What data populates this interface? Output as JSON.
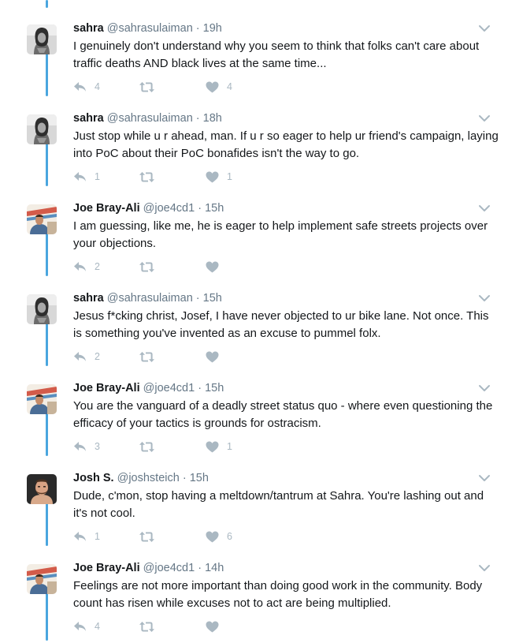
{
  "tweets": [
    {
      "avatar": "avatar-sahra",
      "name": "sahra",
      "handle": "@sahrasulaiman",
      "sep": "·",
      "time": "19h",
      "text": "I genuinely don't understand why you seem to think that folks can't care about traffic deaths AND black lives at the same time...",
      "reply_count": "4",
      "retweet_count": "",
      "like_count": "4"
    },
    {
      "avatar": "avatar-sahra",
      "name": "sahra",
      "handle": "@sahrasulaiman",
      "sep": "·",
      "time": "18h",
      "text": "Just stop while u r ahead, man. If u r so eager to help ur friend's campaign, laying into PoC about their PoC bonafides isn't the way to go.",
      "reply_count": "1",
      "retweet_count": "",
      "like_count": "1"
    },
    {
      "avatar": "avatar-joe",
      "name": "Joe Bray-Ali",
      "handle": "@joe4cd1",
      "sep": "·",
      "time": "15h",
      "text": "I am guessing, like me, he is eager to help implement safe streets projects over your objections.",
      "reply_count": "2",
      "retweet_count": "",
      "like_count": ""
    },
    {
      "avatar": "avatar-sahra",
      "name": "sahra",
      "handle": "@sahrasulaiman",
      "sep": "·",
      "time": "15h",
      "text": "Jesus f*cking christ, Josef, I have never objected to ur bike lane. Not once. This is something you've invented as an excuse to pummel folx.",
      "reply_count": "2",
      "retweet_count": "",
      "like_count": ""
    },
    {
      "avatar": "avatar-joe",
      "name": "Joe Bray-Ali",
      "handle": "@joe4cd1",
      "sep": "·",
      "time": "15h",
      "text": "You are the vanguard of a deadly street status quo - where even questioning the efficacy of your tactics is grounds for ostracism.",
      "reply_count": "3",
      "retweet_count": "",
      "like_count": "1"
    },
    {
      "avatar": "avatar-josh",
      "name": "Josh S.",
      "handle": "@joshsteich",
      "sep": "·",
      "time": "15h",
      "text": "Dude, c'mon, stop having a meltdown/tantrum at Sahra. You're lashing out and it's not cool.",
      "reply_count": "1",
      "retweet_count": "",
      "like_count": "6"
    },
    {
      "avatar": "avatar-joe",
      "name": "Joe Bray-Ali",
      "handle": "@joe4cd1",
      "sep": "·",
      "time": "14h",
      "text": "Feelings are not more important than doing good work in the community. Body count has risen while excuses not to act are being multiplied.",
      "reply_count": "4",
      "retweet_count": "",
      "like_count": ""
    }
  ],
  "colors": {
    "thread_line": "#4aa6df",
    "icon": "#aab8c2",
    "meta_text": "#657786",
    "body_text": "#14171a"
  },
  "icons": {
    "reply": "reply-icon",
    "retweet": "retweet-icon",
    "like": "heart-icon",
    "more": "chevron-down-icon"
  }
}
